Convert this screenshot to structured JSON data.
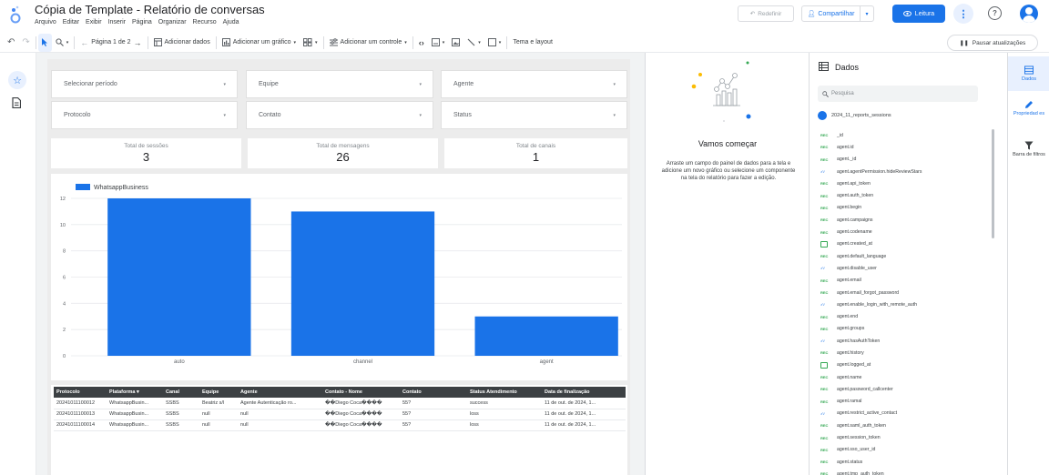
{
  "app": {
    "title": "Cópia de Template - Relatório de conversas",
    "menu": [
      "Arquivo",
      "Editar",
      "Exibir",
      "Inserir",
      "Página",
      "Organizar",
      "Recurso",
      "Ajuda"
    ],
    "redefinir_label": "Redefinir",
    "share_label": "Compartilhar",
    "leitura_label": "Leitura",
    "accent_color": "#1a73e8"
  },
  "toolbar": {
    "page_label": "Página 1 de 2",
    "add_data_label": "Adicionar dados",
    "add_chart_label": "Adicionar um gráfico",
    "add_control_label": "Adicionar um controle",
    "theme_label": "Tema e layout",
    "pause_label": "Pausar atualizações"
  },
  "filters": [
    {
      "label": "Selecionar período"
    },
    {
      "label": "Equipe"
    },
    {
      "label": "Agente"
    },
    {
      "label": "Protocolo"
    },
    {
      "label": "Contato"
    },
    {
      "label": "Status"
    }
  ],
  "scorecards": [
    {
      "label": "Total de sessões",
      "value": "3"
    },
    {
      "label": "Total de mensagens",
      "value": "26"
    },
    {
      "label": "Total de canais",
      "value": "1"
    }
  ],
  "chart_data": {
    "type": "bar",
    "categories": [
      "auto",
      "channel",
      "agent"
    ],
    "series": [
      {
        "name": "WhatsappBusiness",
        "values": [
          12,
          11,
          3
        ],
        "color": "#1a73e8"
      }
    ],
    "ylim": [
      0,
      12
    ],
    "yticks": [
      "0",
      "2",
      "4",
      "6",
      "8",
      "10",
      "12"
    ],
    "legend_position": "top-left",
    "grid": true
  },
  "table": {
    "columns": [
      "Protocolo",
      "Plataforma",
      "Canal",
      "Equipe",
      "Agente",
      "Contato - Nome",
      "Contato",
      "Status Atendimento",
      "Data de finalização"
    ],
    "rows": [
      [
        "20241011100012",
        "WhatsappBusin...",
        "SSBS",
        "Beatriz s/l",
        "Agente Autenticação ro...",
        "��Diego Coca����",
        "55?",
        "success",
        "11 de out. de 2024, 1..."
      ],
      [
        "20241011100013",
        "WhatsappBusin...",
        "SSBS",
        "null",
        "null",
        "��Diego Coca����",
        "55?",
        "loss",
        "11 de out. de 2024, 1..."
      ],
      [
        "20241011100014",
        "WhatsappBusin...",
        "SSBS",
        "null",
        "null",
        "��Diego Coca����",
        "55?",
        "loss",
        "11 de out. de 2024, 1..."
      ]
    ]
  },
  "start_panel": {
    "title": "Vamos começar",
    "text": "Arraste um campo do painel de dados para a tela e adicione um novo gráfico ou selecione um componente na tela do relatório para fazer a edição."
  },
  "data_panel": {
    "title": "Dados",
    "search_placeholder": "Pesquisa",
    "source": "2024_11_reports_sessions",
    "fields": [
      {
        "name": "_id",
        "type": "REC"
      },
      {
        "name": "agent.id",
        "type": "REC"
      },
      {
        "name": "agent._id",
        "type": "REC"
      },
      {
        "name": "agent.agentPermission.hideReviewStars",
        "type": "bool"
      },
      {
        "name": "agent.api_token",
        "type": "REC"
      },
      {
        "name": "agent.auth_token",
        "type": "REC"
      },
      {
        "name": "agent.begin",
        "type": "REC"
      },
      {
        "name": "agent.campaigns",
        "type": "REC"
      },
      {
        "name": "agent.codename",
        "type": "REC"
      },
      {
        "name": "agent.created_at",
        "type": "date"
      },
      {
        "name": "agent.default_language",
        "type": "REC"
      },
      {
        "name": "agent.disable_user",
        "type": "bool"
      },
      {
        "name": "agent.email",
        "type": "REC"
      },
      {
        "name": "agent.email_forgot_password",
        "type": "REC"
      },
      {
        "name": "agent.enable_login_with_remote_auth",
        "type": "bool"
      },
      {
        "name": "agent.end",
        "type": "REC"
      },
      {
        "name": "agent.groups",
        "type": "REC"
      },
      {
        "name": "agent.hasAuthToken",
        "type": "bool"
      },
      {
        "name": "agent.history",
        "type": "REC"
      },
      {
        "name": "agent.logged_at",
        "type": "date"
      },
      {
        "name": "agent.name",
        "type": "REC"
      },
      {
        "name": "agent.password_callcenter",
        "type": "REC"
      },
      {
        "name": "agent.ramal",
        "type": "REC"
      },
      {
        "name": "agent.restrict_active_contact",
        "type": "bool"
      },
      {
        "name": "agent.saml_auth_token",
        "type": "REC"
      },
      {
        "name": "agent.session_token",
        "type": "REC"
      },
      {
        "name": "agent.sso_user_id",
        "type": "REC"
      },
      {
        "name": "agent.status",
        "type": "REC"
      },
      {
        "name": "agent.tmp_auth_token",
        "type": "REC"
      }
    ]
  },
  "right_rail": {
    "dados_label": "Dados",
    "propriedades_label": "Propriedad es",
    "filtros_label": "Barra de filtros"
  }
}
